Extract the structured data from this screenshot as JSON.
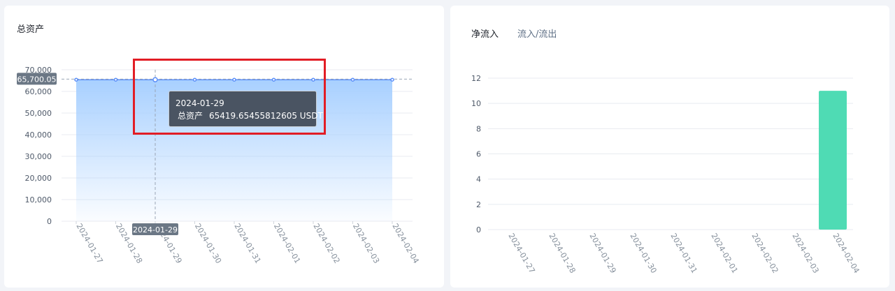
{
  "left_card": {
    "title": "总资产",
    "crosshair_y_label": "65,700.05",
    "crosshair_x_label": "2024-01-29",
    "tooltip": {
      "date": "2024-01-29",
      "series_name": "总资产",
      "value": "65419.65455812605 USDT"
    }
  },
  "right_card": {
    "tabs": [
      "净流入",
      "流入/流出"
    ],
    "active_tab": 0
  },
  "colors": {
    "area_top": "#a8d0ff",
    "line": "#5b8ff9",
    "bar": "#4fdbb4",
    "highlight": "#e21d25"
  },
  "chart_data": [
    {
      "type": "area",
      "title": "总资产",
      "x": [
        "2024-01-27",
        "2024-01-28",
        "2024-01-29",
        "2024-01-30",
        "2024-01-31",
        "2024-02-01",
        "2024-02-02",
        "2024-02-03",
        "2024-02-04"
      ],
      "series": [
        {
          "name": "总资产",
          "values": [
            65419.65,
            65419.65,
            65419.65,
            65419.65,
            65419.65,
            65419.65,
            65419.65,
            65419.65,
            65419.65
          ]
        }
      ],
      "yticks": [
        "0",
        "10,000",
        "20,000",
        "30,000",
        "40,000",
        "50,000",
        "60,000",
        "70,000"
      ],
      "ylim": [
        0,
        70000
      ],
      "grid": true
    },
    {
      "type": "bar",
      "x": [
        "2024-01-27",
        "2024-01-28",
        "2024-01-29",
        "2024-01-30",
        "2024-01-31",
        "2024-02-01",
        "2024-02-02",
        "2024-02-03",
        "2024-02-04"
      ],
      "values": [
        0,
        0,
        0,
        0,
        0,
        0,
        0,
        0,
        11
      ],
      "yticks": [
        "0",
        "2",
        "4",
        "6",
        "8",
        "10",
        "12"
      ],
      "ylim": [
        0,
        12
      ],
      "grid": true
    }
  ]
}
